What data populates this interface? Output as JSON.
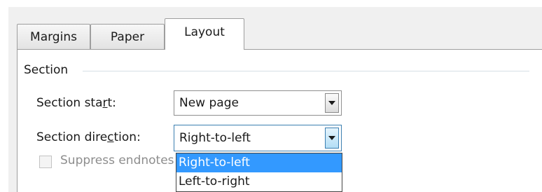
{
  "tabs": [
    {
      "label": "Margins",
      "active": false
    },
    {
      "label": "Paper",
      "active": false
    },
    {
      "label": "Layout",
      "active": true
    }
  ],
  "section": {
    "group_label": "Section",
    "start": {
      "label_before": "Section sta",
      "label_mnemonic": "r",
      "label_after": "t:",
      "value": "New page"
    },
    "direction": {
      "label_before": "Section dire",
      "label_mnemonic": "c",
      "label_after": "tion:",
      "value": "Right-to-left"
    },
    "suppress_endnotes": {
      "label": "Suppress endnotes",
      "checked": false,
      "enabled": false
    }
  },
  "direction_dropdown": {
    "open": true,
    "options": [
      {
        "label": "Right-to-left",
        "selected": true
      },
      {
        "label": "Left-to-right",
        "selected": false
      }
    ]
  },
  "colors": {
    "selection": "#3399ff",
    "dialog_bg": "#f0f0f0",
    "disabled_text": "#8d8d8d"
  }
}
